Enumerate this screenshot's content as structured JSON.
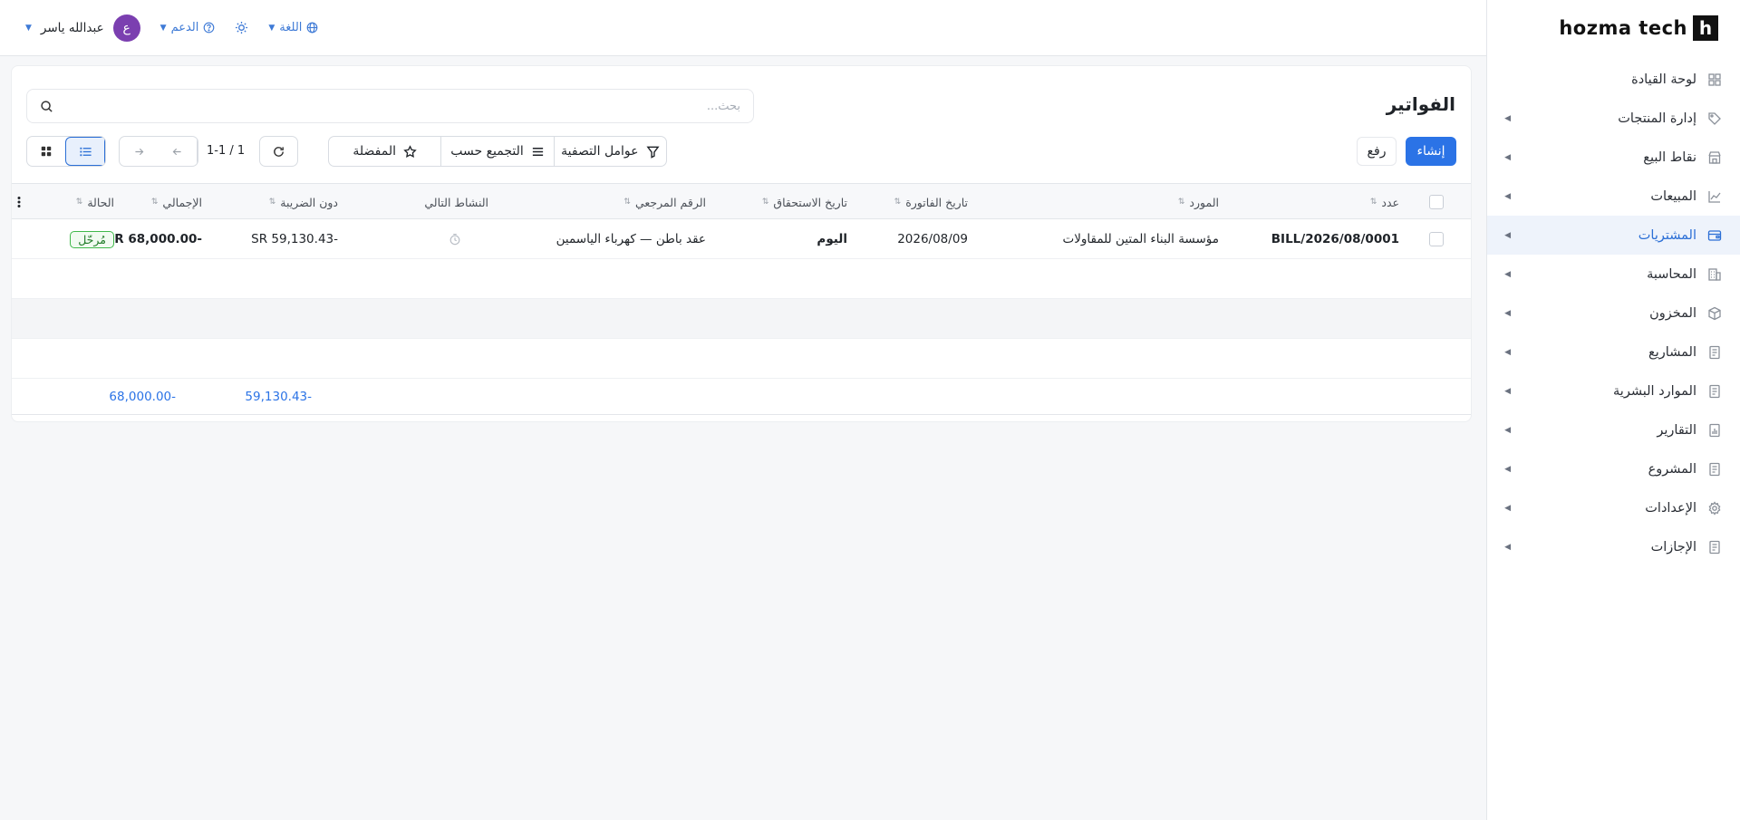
{
  "app": {
    "brand_mark": "h",
    "brand_name": "hozma tech"
  },
  "sidebar": {
    "items": [
      {
        "label": "لوحة القيادة",
        "icon": "dashboard-icon",
        "caret": false,
        "active": false
      },
      {
        "label": "إدارة المنتجات",
        "icon": "tag-icon",
        "caret": true,
        "active": false
      },
      {
        "label": "نقاط البيع",
        "icon": "store-icon",
        "caret": true,
        "active": false
      },
      {
        "label": "المبيعات",
        "icon": "chart-line-icon",
        "caret": true,
        "active": false
      },
      {
        "label": "المشتريات",
        "icon": "wallet-icon",
        "caret": true,
        "active": true
      },
      {
        "label": "المحاسبة",
        "icon": "building-icon",
        "caret": true,
        "active": false
      },
      {
        "label": "المخزون",
        "icon": "box-icon",
        "caret": true,
        "active": false
      },
      {
        "label": "المشاريع",
        "icon": "document-icon",
        "caret": true,
        "active": false
      },
      {
        "label": "الموارد البشرية",
        "icon": "document-icon",
        "caret": true,
        "active": false
      },
      {
        "label": "التقارير",
        "icon": "report-icon",
        "caret": true,
        "active": false
      },
      {
        "label": "المشروع",
        "icon": "document-icon",
        "caret": true,
        "active": false
      },
      {
        "label": "الإعدادات",
        "icon": "gear-icon",
        "caret": true,
        "active": false
      },
      {
        "label": "الإجازات",
        "icon": "document-icon",
        "caret": true,
        "active": false
      }
    ]
  },
  "topbar": {
    "language_label": "اللغة",
    "support_label": "الدعم",
    "user_name": "عبدالله ياسر",
    "user_initial": "ع"
  },
  "page": {
    "title": "الفواتير",
    "search_placeholder": "بحث...",
    "create_label": "إنشاء",
    "upload_label": "رفع",
    "filters_label": "عوامل التصفية",
    "group_by_label": "التجميع حسب",
    "favorites_label": "المفضلة",
    "pager_text": "1-1 / 1"
  },
  "table": {
    "headers": {
      "number": "عدد",
      "vendor": "المورد",
      "invoice_date": "تاريخ الفاتورة",
      "due_date": "تاريخ الاستحقاق",
      "reference": "الرقم المرجعي",
      "next_activity": "النشاط التالي",
      "untaxed": "دون الضريبة",
      "total": "الإجمالي",
      "status": "الحالة"
    },
    "rows": [
      {
        "number": "BILL/2026/08/0001",
        "vendor": "مؤسسة البناء المتين للمقاولات",
        "invoice_date": "2026/08/09",
        "due_date": "اليوم",
        "reference": "عقد باطن — كهرباء الياسمين",
        "untaxed": "SR 59,130.43-",
        "total": "SR 68,000.00-",
        "status": "مُرحّل"
      }
    ],
    "totals": {
      "untaxed": "59,130.43-",
      "total": "68,000.00-"
    }
  },
  "colors": {
    "accent": "#2b73e6",
    "active_nav": "#2b6fd6",
    "avatar": "#7b3fb0",
    "status_green": "#3fb94a"
  }
}
